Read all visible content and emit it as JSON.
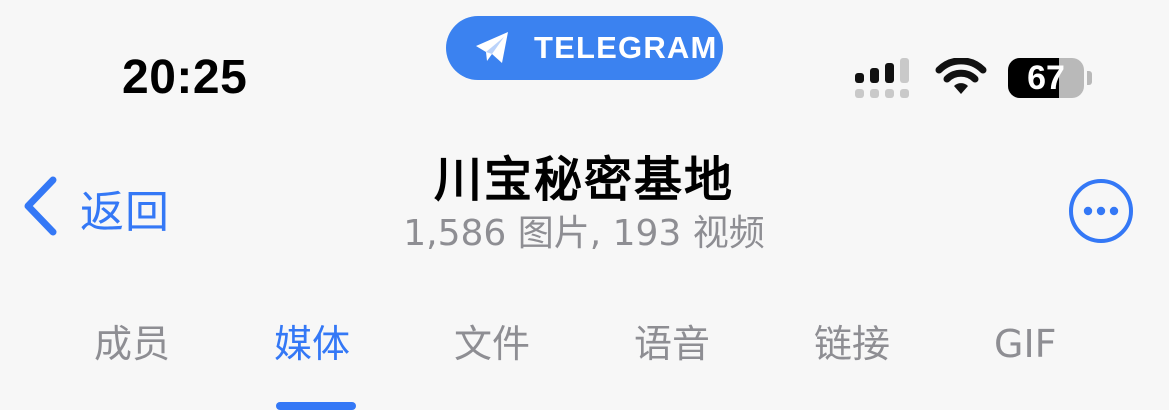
{
  "status_bar": {
    "time": "20:25",
    "app_pill_label": "TELEGRAM",
    "battery_level": "67",
    "battery_fraction": 0.67
  },
  "nav": {
    "back_label": "返回",
    "title": "川宝秘密基地",
    "subtitle": "1,586 图片, 193 视频"
  },
  "tabs": [
    {
      "label": "成员",
      "active": false
    },
    {
      "label": "媒体",
      "active": true
    },
    {
      "label": "文件",
      "active": false
    },
    {
      "label": "语音",
      "active": false
    },
    {
      "label": "链接",
      "active": false
    },
    {
      "label": "GIF",
      "active": false
    }
  ],
  "colors": {
    "accent": "#3478f6",
    "pill": "#3b82f0",
    "secondary_text": "#8e8e93",
    "background": "#f7f7f7"
  },
  "icons": {
    "pill_icon": "telegram-plane-icon",
    "signal": "cellular-signal-icon",
    "wifi": "wifi-icon",
    "battery": "battery-icon",
    "back": "chevron-left-icon",
    "more": "ellipsis-circle-icon"
  }
}
